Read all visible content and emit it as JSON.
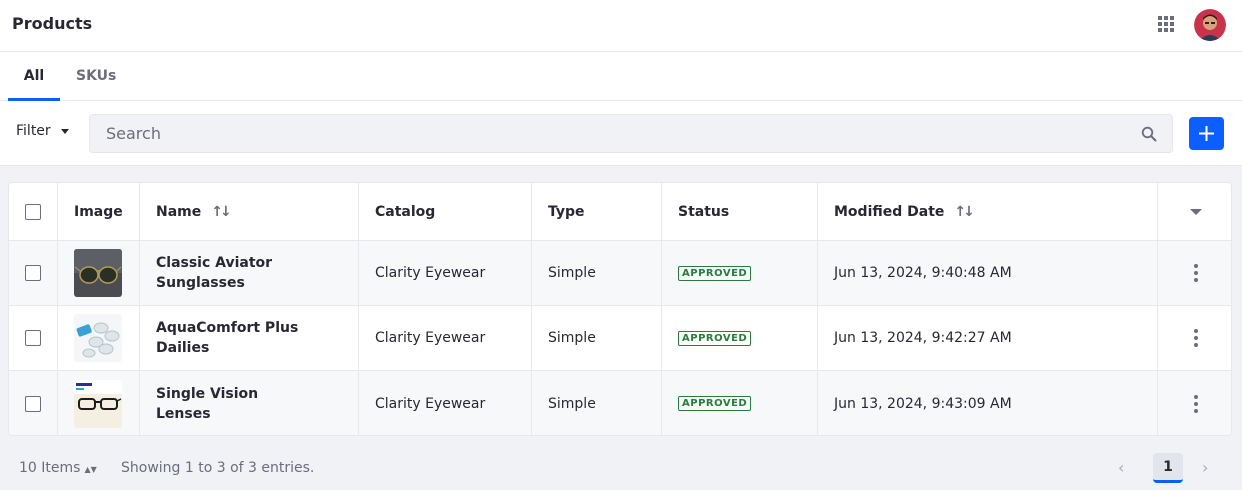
{
  "header": {
    "title": "Products",
    "apps_icon": "grid-icon",
    "avatar_icon": "user-avatar"
  },
  "tabs": [
    {
      "label": "All",
      "active": true
    },
    {
      "label": "SKUs",
      "active": false
    }
  ],
  "toolbar": {
    "filter_label": "Filter",
    "search_placeholder": "Search",
    "search_value": "",
    "add_icon": "plus-icon"
  },
  "table": {
    "columns": [
      "Image",
      "Name",
      "Catalog",
      "Type",
      "Status",
      "Modified Date"
    ],
    "rows": [
      {
        "image": "aviator-sunglasses-image",
        "name": "Classic Aviator Sunglasses",
        "catalog": "Clarity Eyewear",
        "type": "Simple",
        "status": "APPROVED",
        "modified": "Jun 13, 2024, 9:40:48 AM"
      },
      {
        "image": "contact-lenses-image",
        "name": "AquaComfort Plus Dailies",
        "catalog": "Clarity Eyewear",
        "type": "Simple",
        "status": "APPROVED",
        "modified": "Jun 13, 2024, 9:42:27 AM"
      },
      {
        "image": "eyeglasses-image",
        "name": "Single Vision Lenses",
        "catalog": "Clarity Eyewear",
        "type": "Simple",
        "status": "APPROVED",
        "modified": "Jun 13, 2024, 9:43:09 AM"
      }
    ]
  },
  "footer": {
    "items_per_page": "10 Items",
    "entries_text": "Showing 1 to 3 of 3 entries.",
    "current_page": "1",
    "prev_glyph": "‹",
    "next_glyph": "›"
  },
  "colors": {
    "accent": "#0b5fff",
    "status_approved": "#287d3c",
    "text": "#272833",
    "muted": "#6b6c7e"
  }
}
